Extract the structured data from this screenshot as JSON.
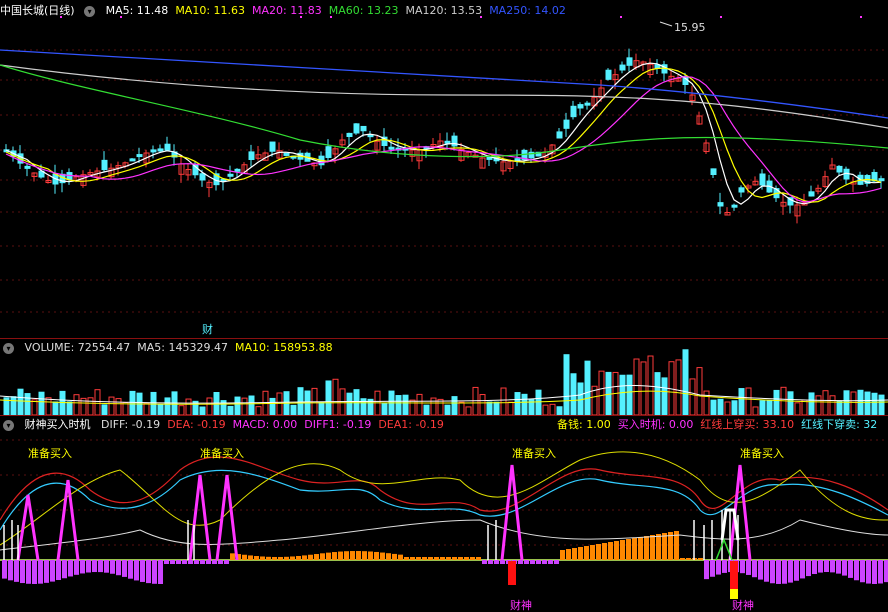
{
  "colors": {
    "up": "#ff3b3b",
    "down": "#54f0ff",
    "ma5": "#ffffff",
    "ma10": "#ffff00",
    "ma20": "#ff33ff",
    "ma60": "#33dd33",
    "ma120": "#cccccc",
    "ma250": "#3355ff",
    "macd_pos": "#ff8800",
    "macd_neg": "#cc44ff"
  },
  "main_panel": {
    "title": "中国长城(日线)",
    "indicators": [
      {
        "label": "MA5: 11.48",
        "color": "#ffffff"
      },
      {
        "label": "MA10: 11.63",
        "color": "#ffff00"
      },
      {
        "label": "MA20: 11.83",
        "color": "#ff33ff"
      },
      {
        "label": "MA60: 13.23",
        "color": "#33dd33"
      },
      {
        "label": "MA120: 13.53",
        "color": "#cccccc"
      },
      {
        "label": "MA250: 14.02",
        "color": "#3355ff"
      }
    ],
    "high_label": "15.95",
    "marker_label": "财"
  },
  "volume_panel": {
    "indicators": [
      {
        "label": "VOLUME: 72554.47",
        "color": "#dddddd"
      },
      {
        "label": "MA5: 145329.47",
        "color": "#dddddd"
      },
      {
        "label": "MA10: 158953.88",
        "color": "#ffff00"
      }
    ]
  },
  "indicator_panel": {
    "title": "财神买入时机",
    "left_items": [
      {
        "label": "DIFF: -0.19",
        "color": "#dddddd"
      },
      {
        "label": "DEA: -0.19",
        "color": "#ff3b3b"
      },
      {
        "label": "MACD: 0.00",
        "color": "#ff33ff"
      },
      {
        "label": "DIFF1: -0.19",
        "color": "#ff33ff"
      },
      {
        "label": "DEA1: -0.19",
        "color": "#ff3b3b"
      }
    ],
    "right_items": [
      {
        "label": "备钱: 1.00",
        "color": "#ffff00"
      },
      {
        "label": "买入时机: 0.00",
        "color": "#ff33ff"
      },
      {
        "label": "红线上穿买: 33.10",
        "color": "#ff3b3b"
      },
      {
        "label": "红线下穿卖: 32",
        "color": "#54f0ff"
      }
    ],
    "signal_labels": [
      "准备买入",
      "准备买入",
      "准备买入",
      "准备买入"
    ],
    "caishen_labels": [
      "财神",
      "财神"
    ]
  }
}
